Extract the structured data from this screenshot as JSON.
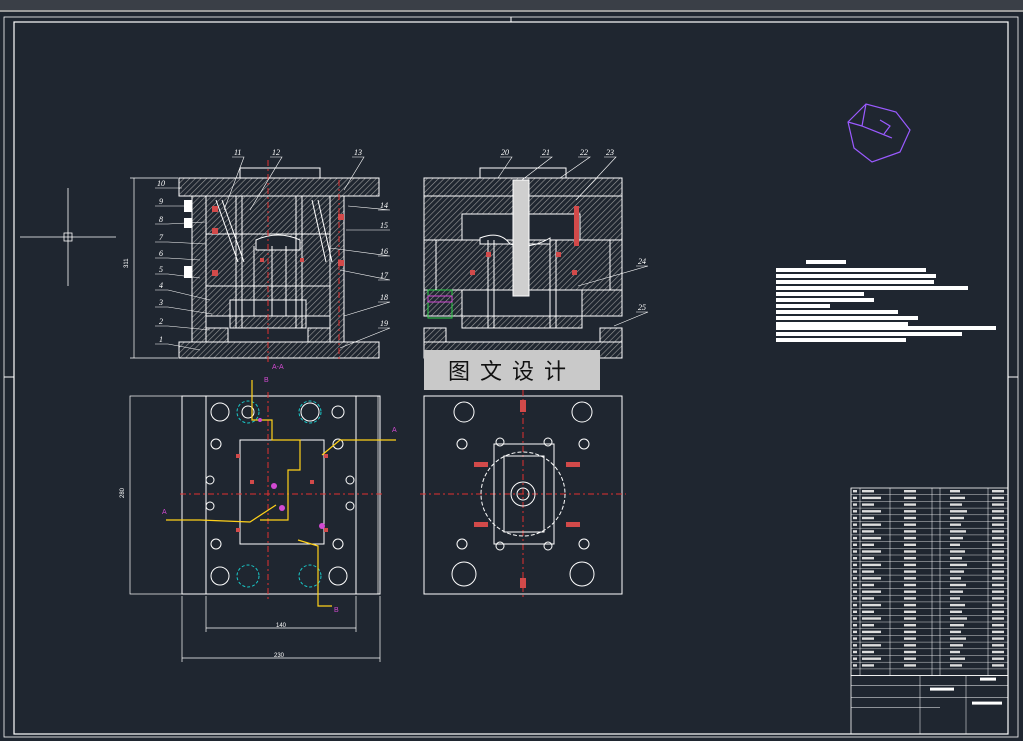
{
  "watermark": "图文设计",
  "balloons": [
    "1",
    "2",
    "3",
    "4",
    "5",
    "6",
    "7",
    "8",
    "9",
    "10",
    "11",
    "12",
    "13",
    "14",
    "15",
    "16",
    "17",
    "18",
    "19",
    "20",
    "21",
    "22",
    "23",
    "24",
    "25"
  ],
  "dims": {
    "height_side": "311",
    "width_top_inner": "140",
    "width_top_outer": "230",
    "height_top": "280"
  },
  "section_marks": {
    "aa": "A-A",
    "a": "A",
    "b": "B"
  },
  "colors": {
    "background": "#1f2630",
    "line": "#ffffff",
    "hatch": "#bfbfbf",
    "hidden": "#d24a4a",
    "center": "#e03030",
    "cyan": "#19c9c9",
    "yellow": "#ffd11a",
    "magenta": "#d24ad2",
    "green": "#2fd24a",
    "purple": "#9a5aff"
  }
}
